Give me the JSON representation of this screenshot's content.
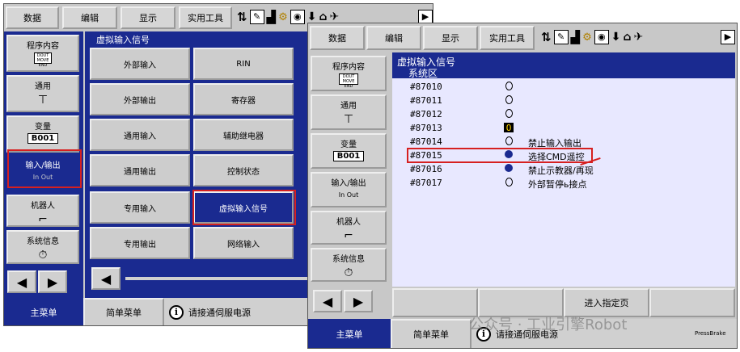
{
  "back": {
    "menu": [
      "数据",
      "编辑",
      "显示",
      "实用工具"
    ],
    "sidebar": [
      {
        "label": "程序内容",
        "icon": "program-content-icon",
        "glyph": "DOUT MOVE END"
      },
      {
        "label": "通用",
        "icon": "tool-icon",
        "glyph": "⊤"
      },
      {
        "label": "变量",
        "icon": "variable-icon",
        "glyph": "B001"
      },
      {
        "label": "输入/输出",
        "icon": "io-icon",
        "glyph": "In Out"
      },
      {
        "label": "机器人",
        "icon": "robot-icon",
        "glyph": "⌐"
      },
      {
        "label": "系统信息",
        "icon": "system-info-icon",
        "glyph": "⏱"
      }
    ],
    "header": "虚拟输入信号",
    "grid": [
      [
        "外部输入",
        "RIN"
      ],
      [
        "外部输出",
        "寄存器"
      ],
      [
        "通用输入",
        "辅助继电器"
      ],
      [
        "通用输出",
        "控制状态"
      ],
      [
        "专用输入",
        "虚拟输入信号"
      ],
      [
        "专用输出",
        "网络输入"
      ]
    ],
    "bottom": {
      "main": "主菜单",
      "simple": "简单菜单",
      "msg": "请接通伺服电源"
    }
  },
  "front": {
    "menu": [
      "数据",
      "编辑",
      "显示",
      "实用工具"
    ],
    "sidebar": [
      {
        "label": "程序内容",
        "glyph": "DOUT MOVE END"
      },
      {
        "label": "通用",
        "glyph": "⊤"
      },
      {
        "label": "变量",
        "glyph": "B001"
      },
      {
        "label": "输入/输出",
        "glyph": "In Out"
      },
      {
        "label": "机器人",
        "glyph": "⌐"
      },
      {
        "label": "系统信息",
        "glyph": "⏱"
      }
    ],
    "title": "虚拟输入信号",
    "subtitle": "系统区",
    "rows": [
      {
        "addr": "#87010",
        "state": "off",
        "desc": ""
      },
      {
        "addr": "#87011",
        "state": "off",
        "desc": ""
      },
      {
        "addr": "#87012",
        "state": "off",
        "desc": ""
      },
      {
        "addr": "#87013",
        "state": "cursor",
        "desc": ""
      },
      {
        "addr": "#87014",
        "state": "off",
        "desc": "禁止输入输出"
      },
      {
        "addr": "#87015",
        "state": "on",
        "desc": "选择CMD遥控"
      },
      {
        "addr": "#87016",
        "state": "on",
        "desc": "禁止示教器/再现"
      },
      {
        "addr": "#87017",
        "state": "off",
        "desc": "外部暂停ь接点"
      }
    ],
    "func": [
      "",
      "",
      "进入指定页",
      ""
    ],
    "bottom": {
      "main": "主菜单",
      "simple": "简单菜单",
      "msg": "请接通伺服电源",
      "tag": "PressBrake"
    }
  },
  "watermark": "公众号 · 工业引擎Robot",
  "colors": {
    "panel_blue": "#1a2a90",
    "highlight_red": "#d62020",
    "screen_bg": "#e8e8ff"
  }
}
